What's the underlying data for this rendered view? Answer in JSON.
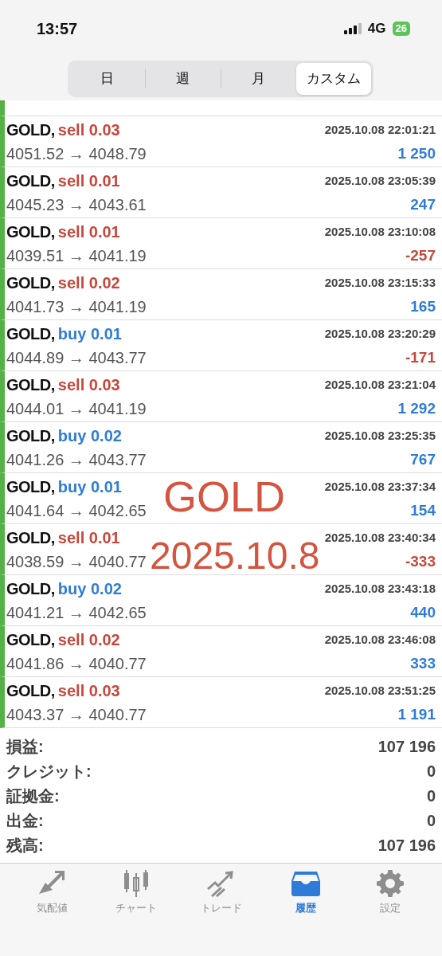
{
  "status_bar": {
    "time": "13:57",
    "network": "4G",
    "battery": "26"
  },
  "period_tabs": [
    {
      "label": "日",
      "selected": false
    },
    {
      "label": "週",
      "selected": false
    },
    {
      "label": "月",
      "selected": false
    },
    {
      "label": "カスタム",
      "selected": true
    }
  ],
  "deals": [
    {
      "symbol": "GOLD,",
      "order": "sell 0.03",
      "kind": "sell",
      "time": "2025.10.08 22:01:21",
      "prices": "4051.52 → 4048.79",
      "profit": "1 250",
      "loss": false
    },
    {
      "symbol": "GOLD,",
      "order": "sell 0.01",
      "kind": "sell",
      "time": "2025.10.08 23:05:39",
      "prices": "4045.23 → 4043.61",
      "profit": "247",
      "loss": false
    },
    {
      "symbol": "GOLD,",
      "order": "sell 0.01",
      "kind": "sell",
      "time": "2025.10.08 23:10:08",
      "prices": "4039.51 → 4041.19",
      "profit": "-257",
      "loss": true
    },
    {
      "symbol": "GOLD,",
      "order": "sell 0.02",
      "kind": "sell",
      "time": "2025.10.08 23:15:33",
      "prices": "4041.73 → 4041.19",
      "profit": "165",
      "loss": false
    },
    {
      "symbol": "GOLD,",
      "order": "buy 0.01",
      "kind": "buy",
      "time": "2025.10.08 23:20:29",
      "prices": "4044.89 → 4043.77",
      "profit": "-171",
      "loss": true
    },
    {
      "symbol": "GOLD,",
      "order": "sell 0.03",
      "kind": "sell",
      "time": "2025.10.08 23:21:04",
      "prices": "4044.01 → 4041.19",
      "profit": "1 292",
      "loss": false
    },
    {
      "symbol": "GOLD,",
      "order": "buy 0.02",
      "kind": "buy",
      "time": "2025.10.08 23:25:35",
      "prices": "4041.26 → 4043.77",
      "profit": "767",
      "loss": false
    },
    {
      "symbol": "GOLD,",
      "order": "buy 0.01",
      "kind": "buy",
      "time": "2025.10.08 23:37:34",
      "prices": "4041.64 → 4042.65",
      "profit": "154",
      "loss": false
    },
    {
      "symbol": "GOLD,",
      "order": "sell 0.01",
      "kind": "sell",
      "time": "2025.10.08 23:40:34",
      "prices": "4038.59 → 4040.77",
      "profit": "-333",
      "loss": true
    },
    {
      "symbol": "GOLD,",
      "order": "buy 0.02",
      "kind": "buy",
      "time": "2025.10.08 23:43:18",
      "prices": "4041.21 → 4042.65",
      "profit": "440",
      "loss": false
    },
    {
      "symbol": "GOLD,",
      "order": "sell 0.02",
      "kind": "sell",
      "time": "2025.10.08 23:46:08",
      "prices": "4041.86 → 4040.77",
      "profit": "333",
      "loss": false
    },
    {
      "symbol": "GOLD,",
      "order": "sell 0.03",
      "kind": "sell",
      "time": "2025.10.08 23:51:25",
      "prices": "4043.37 → 4040.77",
      "profit": "1 191",
      "loss": false
    }
  ],
  "annotation": {
    "line_1": "GOLD",
    "line_2": "2025.10.8"
  },
  "summary": [
    {
      "label": "損益:",
      "value": "107 196"
    },
    {
      "label": "クレジット:",
      "value": "0"
    },
    {
      "label": "証拠金:",
      "value": "0"
    },
    {
      "label": "出金:",
      "value": "0"
    },
    {
      "label": "残高:",
      "value": "107 196"
    }
  ],
  "bottom_tabs": [
    {
      "label": "気配値",
      "kind": "quotes",
      "selected": false
    },
    {
      "label": "チャート",
      "kind": "chart",
      "selected": false
    },
    {
      "label": "トレード",
      "kind": "trade",
      "selected": false
    },
    {
      "label": "履歴",
      "kind": "history",
      "selected": true
    },
    {
      "label": "設定",
      "kind": "settings",
      "selected": false
    }
  ]
}
